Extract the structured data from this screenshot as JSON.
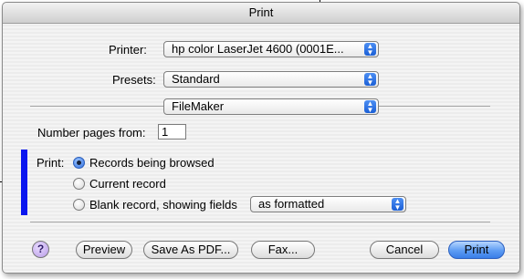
{
  "window": {
    "title": "Print"
  },
  "printer": {
    "label": "Printer:",
    "value": "hp color LaserJet 4600 (0001E..."
  },
  "presets": {
    "label": "Presets:",
    "value": "Standard"
  },
  "panel": {
    "value": "FileMaker"
  },
  "number_pages": {
    "label": "Number pages from:",
    "value": "1"
  },
  "print_section": {
    "label": "Print:",
    "options": [
      {
        "label": "Records being browsed",
        "selected": true
      },
      {
        "label": "Current record",
        "selected": false
      },
      {
        "label": "Blank record, showing fields",
        "selected": false
      }
    ],
    "blank_format": {
      "value": "as formatted"
    }
  },
  "buttons": {
    "help": "?",
    "preview": "Preview",
    "save_pdf": "Save As PDF...",
    "fax": "Fax...",
    "cancel": "Cancel",
    "print": "Print"
  },
  "icons": {
    "popup_arrows": "⬍"
  },
  "colors": {
    "annotation_bar": "#0a16ef",
    "default_button": "#3a7ee8"
  }
}
